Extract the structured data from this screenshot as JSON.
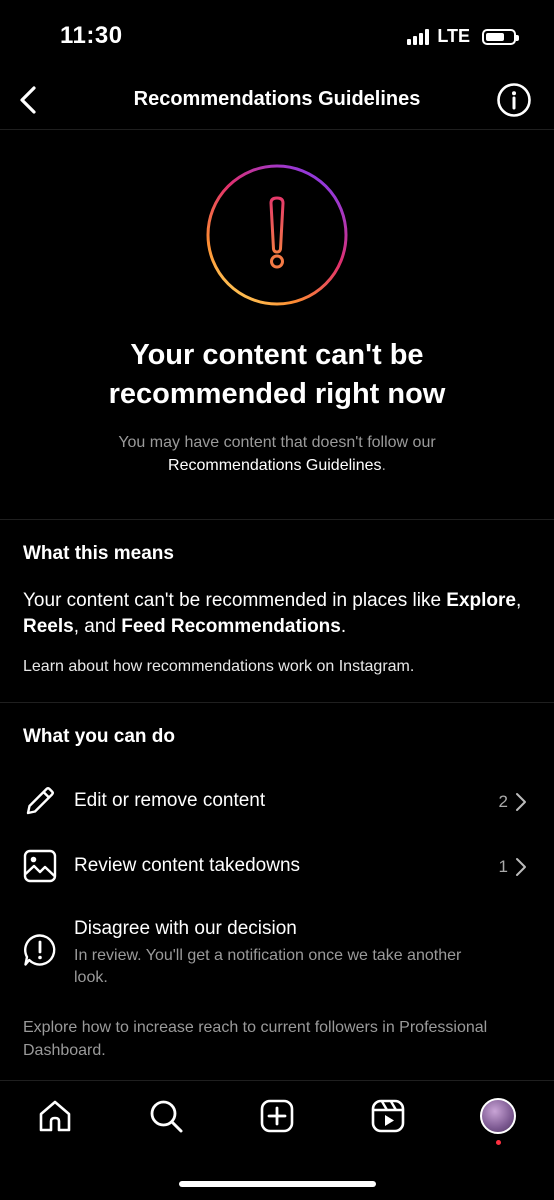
{
  "status_bar": {
    "time": "11:30",
    "network": "LTE"
  },
  "header": {
    "title": "Recommendations Guidelines"
  },
  "hero": {
    "title_line1": "Your content can't be",
    "title_line2": "recommended right now",
    "subtitle_line1": "You may have content that doesn't follow our",
    "subtitle_link": "Recommendations Guidelines",
    "subtitle_end": "."
  },
  "what_this_means": {
    "heading": "What this means",
    "body_start": "Your content can't be recommended in places like ",
    "explore": "Explore",
    "sep1": ", ",
    "reels": "Reels",
    "sep2": ", and ",
    "feed": "Feed Recommendations",
    "end": ".",
    "learn_link": "Learn about how recommendations work on Instagram."
  },
  "what_you_can_do": {
    "heading": "What you can do",
    "items": [
      {
        "label": "Edit or remove content",
        "count": "2",
        "icon": "pencil-icon"
      },
      {
        "label": "Review content takedowns",
        "count": "1",
        "icon": "image-icon"
      },
      {
        "label": "Disagree with our decision",
        "description": "In review. You'll get a notification once we take another look.",
        "icon": "alert-bubble-icon"
      }
    ],
    "footer": "Explore how to increase reach to current followers in Professional Dashboard."
  },
  "tab_bar": {
    "tabs": [
      "home-icon",
      "search-icon",
      "create-icon",
      "reels-icon",
      "profile-avatar"
    ]
  },
  "colors": {
    "background": "#000000",
    "secondary_text": "#9a9a9a",
    "gradient": [
      "#7a3cff",
      "#e1306c",
      "#fd8d32",
      "#ffd25e"
    ],
    "notification_dot": "#ff3040"
  }
}
